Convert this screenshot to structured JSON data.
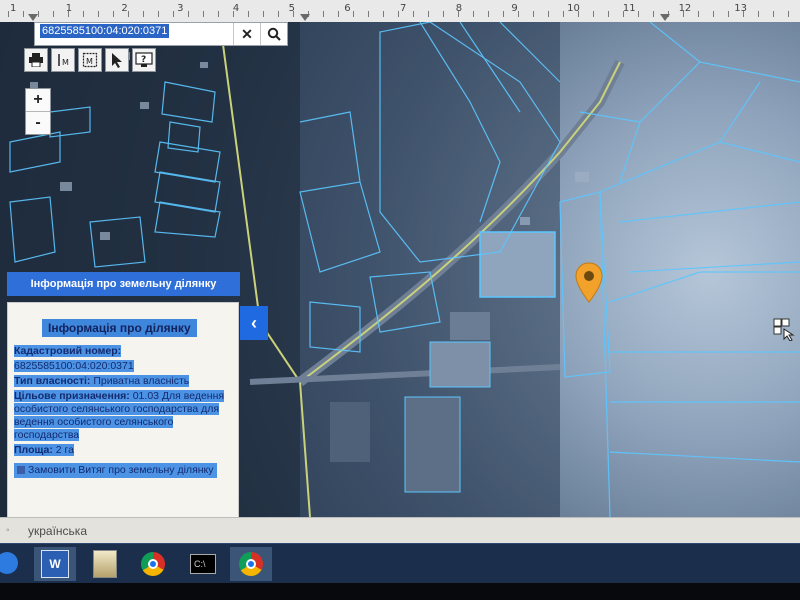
{
  "ruler": {
    "numbers": [
      "1",
      "1",
      "2",
      "3",
      "4",
      "5",
      "6",
      "7",
      "8",
      "9",
      "10",
      "11",
      "12",
      "13"
    ]
  },
  "search": {
    "value": "6825585100:04:020:0371",
    "clear_label": "✕",
    "search_label": "🔍"
  },
  "toolbar": {
    "tools": [
      "print-icon",
      "measure-line-icon",
      "measure-area-icon",
      "pointer-icon",
      "help-icon"
    ]
  },
  "zoom": {
    "in_label": "+",
    "out_label": "-"
  },
  "banner": {
    "label": "Інформація про земельну ділянку"
  },
  "panel": {
    "title": "Інформація про ділянку",
    "cadastral_label": "Кадастровий номер:",
    "cadastral_value": "6825585100:04:020:0371",
    "ownership_label": "Тип власності:",
    "ownership_value": "Приватна власність",
    "purpose_label": "Цільове призначення:",
    "purpose_value": "01.03 Для ведення особистого селянського господарства для ведення особистого селянського господарства",
    "area_label": "Площа:",
    "area_value": "2 га",
    "order_label": "Замовити Витяг про земельну ділянку"
  },
  "collapse": {
    "label": "‹"
  },
  "status": {
    "language": "українська"
  },
  "taskbar": {
    "word_label": "W",
    "cmd_label": "C:\\"
  },
  "colors": {
    "accent": "#2f6fd9",
    "panel_highlight": "#4c93e6",
    "pin": "#f2a22a",
    "parcel_line": "#5cc6ff"
  }
}
